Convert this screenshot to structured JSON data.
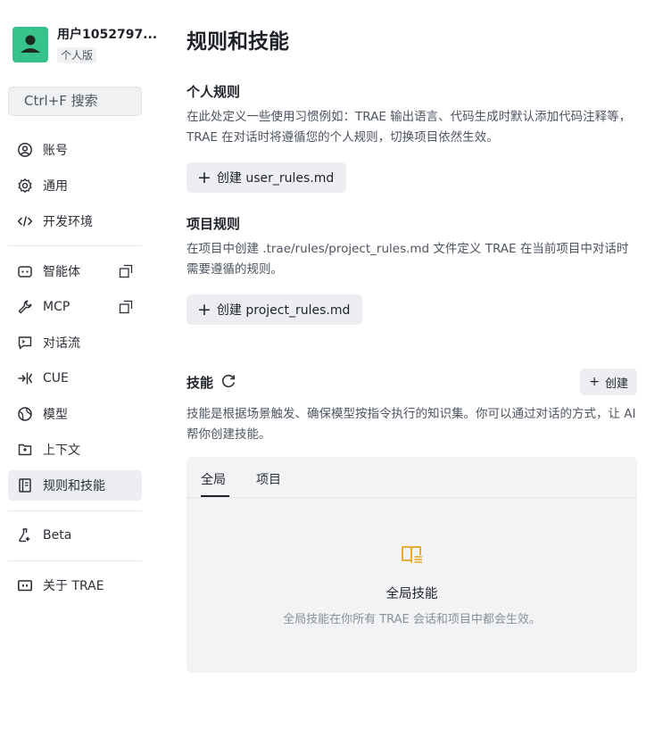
{
  "user": {
    "name": "用户1052797...",
    "badge": "个人版"
  },
  "search": {
    "label": "Ctrl+F 搜索"
  },
  "sidebar": {
    "items": [
      {
        "label": "账号"
      },
      {
        "label": "通用"
      },
      {
        "label": "开发环境"
      },
      {
        "label": "智能体"
      },
      {
        "label": "MCP"
      },
      {
        "label": "对话流"
      },
      {
        "label": "CUE"
      },
      {
        "label": "模型"
      },
      {
        "label": "上下文"
      },
      {
        "label": "规则和技能"
      },
      {
        "label": "Beta"
      },
      {
        "label": "关于 TRAE"
      }
    ]
  },
  "main": {
    "title": "规则和技能",
    "personal": {
      "title": "个人规则",
      "desc": "在此处定义一些使用习惯例如：TRAE 输出语言、代码生成时默认添加代码注释等，TRAE 在对话时将遵循您的个人规则，切换项目依然生效。",
      "button": "创建 user_rules.md"
    },
    "project": {
      "title": "项目规则",
      "desc": "在项目中创建 .trae/rules/project_rules.md 文件定义 TRAE 在当前项目中对话时需要遵循的规则。",
      "button": "创建 project_rules.md"
    },
    "skills": {
      "title": "技能",
      "create": "创建",
      "desc": "技能是根据场景触发、确保模型按指令执行的知识集。你可以通过对话的方式，让 AI 帮你创建技能。",
      "tabs": [
        "全局",
        "项目"
      ],
      "empty_title": "全局技能",
      "empty_desc": "全局技能在你所有 TRAE 会话和项目中都会生效。"
    }
  },
  "colors": {
    "accent": "#36c28a",
    "empty_icon": "#e8a31a"
  }
}
